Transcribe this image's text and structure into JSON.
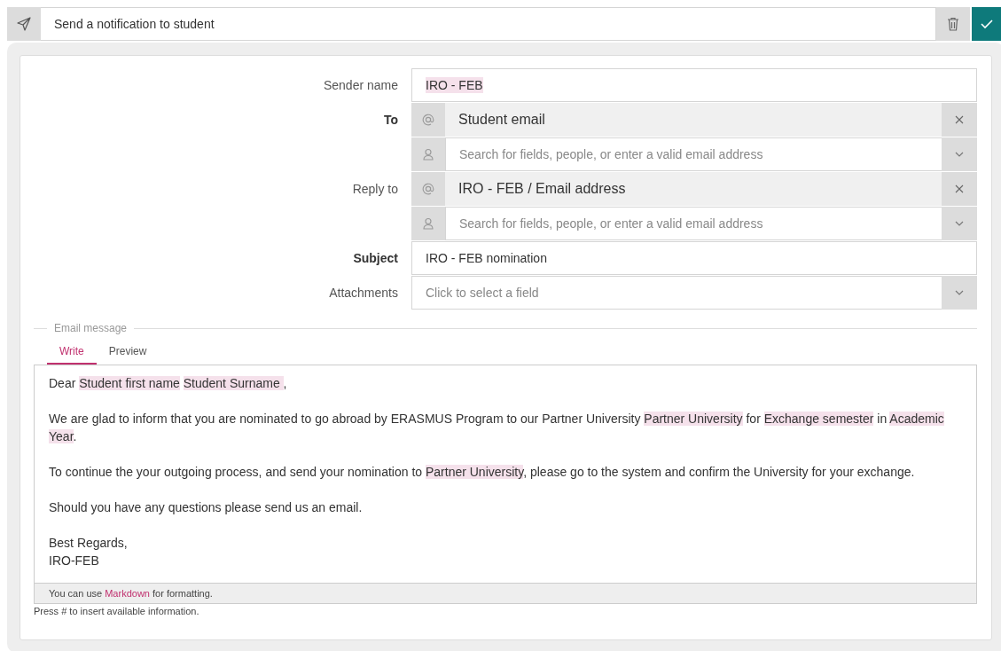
{
  "header": {
    "title": "Send a notification to student"
  },
  "fields": [
    {
      "kind": "text",
      "label": "Sender name",
      "bold": false,
      "value": "IRO - FEB",
      "highlighted": true
    },
    {
      "kind": "recipients",
      "label": "To",
      "bold": true,
      "chip": "Student email",
      "placeholder": "Search for fields, people, or enter a valid email address"
    },
    {
      "kind": "recipients",
      "label": "Reply to",
      "bold": false,
      "chip": "IRO - FEB / Email address",
      "placeholder": "Search for fields, people, or enter a valid email address"
    },
    {
      "kind": "text",
      "label": "Subject",
      "bold": true,
      "value": "IRO - FEB nomination",
      "highlighted": false
    },
    {
      "kind": "select",
      "label": "Attachments",
      "bold": false,
      "placeholder": "Click to select a field"
    }
  ],
  "message": {
    "legend": "Email message",
    "tabs": [
      {
        "label": "Write",
        "selected": true
      },
      {
        "label": "Preview",
        "selected": false
      }
    ],
    "paragraphs": [
      [
        {
          "kind": "text",
          "text": "Dear "
        },
        {
          "kind": "token",
          "text": "Student first name",
          "space_after": true
        },
        {
          "kind": "token",
          "text": "Student Surname "
        },
        {
          "kind": "text",
          "text": ","
        }
      ],
      [
        {
          "kind": "text",
          "text": "We are glad to inform that you are nominated to go abroad by ERASMUS Program to our Partner University "
        },
        {
          "kind": "token",
          "text": "Partner University"
        },
        {
          "kind": "text",
          "text": " for "
        },
        {
          "kind": "token",
          "text": "Exchange semester"
        },
        {
          "kind": "text",
          "text": " in "
        },
        {
          "kind": "token",
          "text": "Academic Year"
        },
        {
          "kind": "text",
          "text": "."
        }
      ],
      [
        {
          "kind": "text",
          "text": "To continue the your outgoing process, and send your nomination to "
        },
        {
          "kind": "token",
          "text": "Partner University"
        },
        {
          "kind": "text",
          "text": ", please go to the system and confirm the University for your exchange."
        }
      ],
      [
        {
          "kind": "text",
          "text": "Should you have any questions please send us an email."
        }
      ],
      [
        {
          "kind": "text",
          "text": "Best Regards,"
        },
        {
          "kind": "break"
        },
        {
          "kind": "text",
          "text": "IRO-FEB"
        }
      ]
    ],
    "footer": {
      "before": "You can use ",
      "link": "Markdown",
      "after": " for formatting."
    },
    "hint": "Press # to insert available information."
  }
}
